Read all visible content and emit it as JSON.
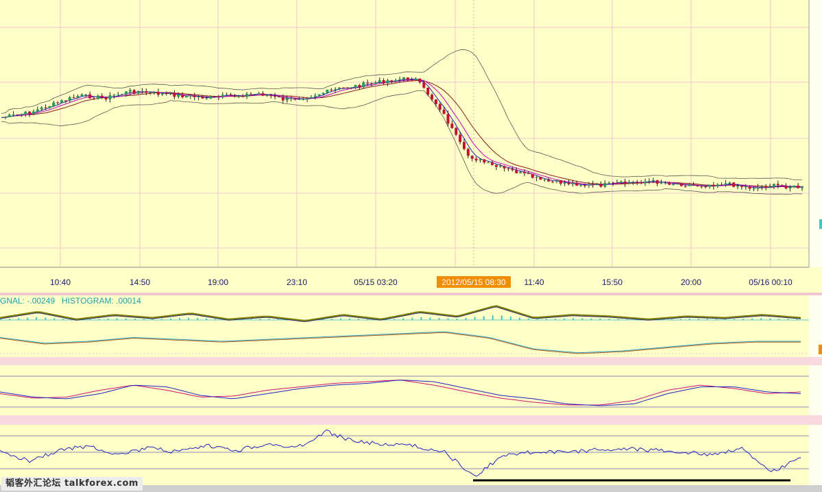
{
  "chart_data": [
    {
      "type": "candlestick",
      "title": "",
      "x_ticks": [
        "10:40",
        "14:50",
        "19:00",
        "23:10",
        "05/15 03:20",
        "2012/05/15 08:30",
        "11:40",
        "15:50",
        "20:00",
        "05/16 00:10"
      ],
      "highlighted_tick": "2012/05/15 08:30",
      "overlays": [
        "bollinger-bands",
        "moving-average-fast",
        "moving-average-medium",
        "moving-average-slow"
      ],
      "series": [
        {
          "name": "close",
          "values": [
            62,
            64,
            68,
            72,
            71,
            74,
            73,
            72,
            71,
            72,
            73,
            70,
            72,
            75,
            77,
            79,
            80,
            66,
            45,
            40,
            37,
            33,
            32,
            31,
            32,
            33,
            32,
            31,
            32,
            30,
            31,
            30
          ]
        }
      ],
      "grid": true
    },
    {
      "type": "line",
      "label_prefix": "GNAL: ",
      "signal_value": "-.00249",
      "histogram_label": "HISTOGRAM: ",
      "histogram_value": ".00014",
      "series": [
        {
          "values": [
            0.2,
            0.6,
            0.1,
            0.4,
            0.2,
            0.5,
            0.1,
            0.3,
            0.0,
            0.4,
            0.1,
            0.6,
            0.3,
            1.0,
            0.2,
            0.4,
            0.3,
            0.1,
            0.3,
            0.2,
            0.4,
            0.2
          ]
        },
        {
          "values": [
            -0.3,
            -0.6,
            -0.5,
            -0.3,
            -0.4,
            -0.5,
            -0.4,
            -0.3,
            -0.2,
            -0.1,
            0.0,
            -0.3,
            -0.9,
            -1.1,
            -1.0,
            -0.8,
            -0.6,
            -0.5,
            -0.5
          ]
        }
      ]
    },
    {
      "type": "line",
      "series": [
        {
          "values": [
            0.5,
            0.35,
            0.3,
            0.45,
            0.7,
            0.65,
            0.4,
            0.3,
            0.45,
            0.6,
            0.7,
            0.75,
            0.85,
            0.8,
            0.6,
            0.4,
            0.3,
            0.15,
            0.1,
            0.15,
            0.45,
            0.65,
            0.65,
            0.5,
            0.45
          ]
        },
        {
          "values": [
            0.45,
            0.32,
            0.35,
            0.55,
            0.7,
            0.55,
            0.35,
            0.38,
            0.55,
            0.65,
            0.75,
            0.8,
            0.85,
            0.7,
            0.5,
            0.32,
            0.2,
            0.12,
            0.12,
            0.25,
            0.55,
            0.7,
            0.6,
            0.45,
            0.5
          ]
        }
      ]
    },
    {
      "type": "line",
      "series": [
        {
          "values": [
            0.5,
            0.3,
            0.55,
            0.65,
            0.45,
            0.6,
            0.5,
            0.65,
            0.55,
            0.7,
            0.6,
            1.0,
            0.75,
            0.7,
            0.65,
            0.5,
            -0.1,
            0.45,
            0.5,
            0.5,
            0.55,
            0.6,
            0.55,
            0.5,
            0.45,
            0.6,
            0.0,
            0.4
          ]
        }
      ]
    }
  ],
  "watermark": "韬客外汇论坛 talkforex.com",
  "colors": {
    "background": "#ffffc8",
    "grid": "#f2c6d0",
    "bull": "#2a9a54",
    "bear": "#c8102e",
    "macd_hist": "#3cc8c8",
    "highlight": "#f08c00"
  }
}
